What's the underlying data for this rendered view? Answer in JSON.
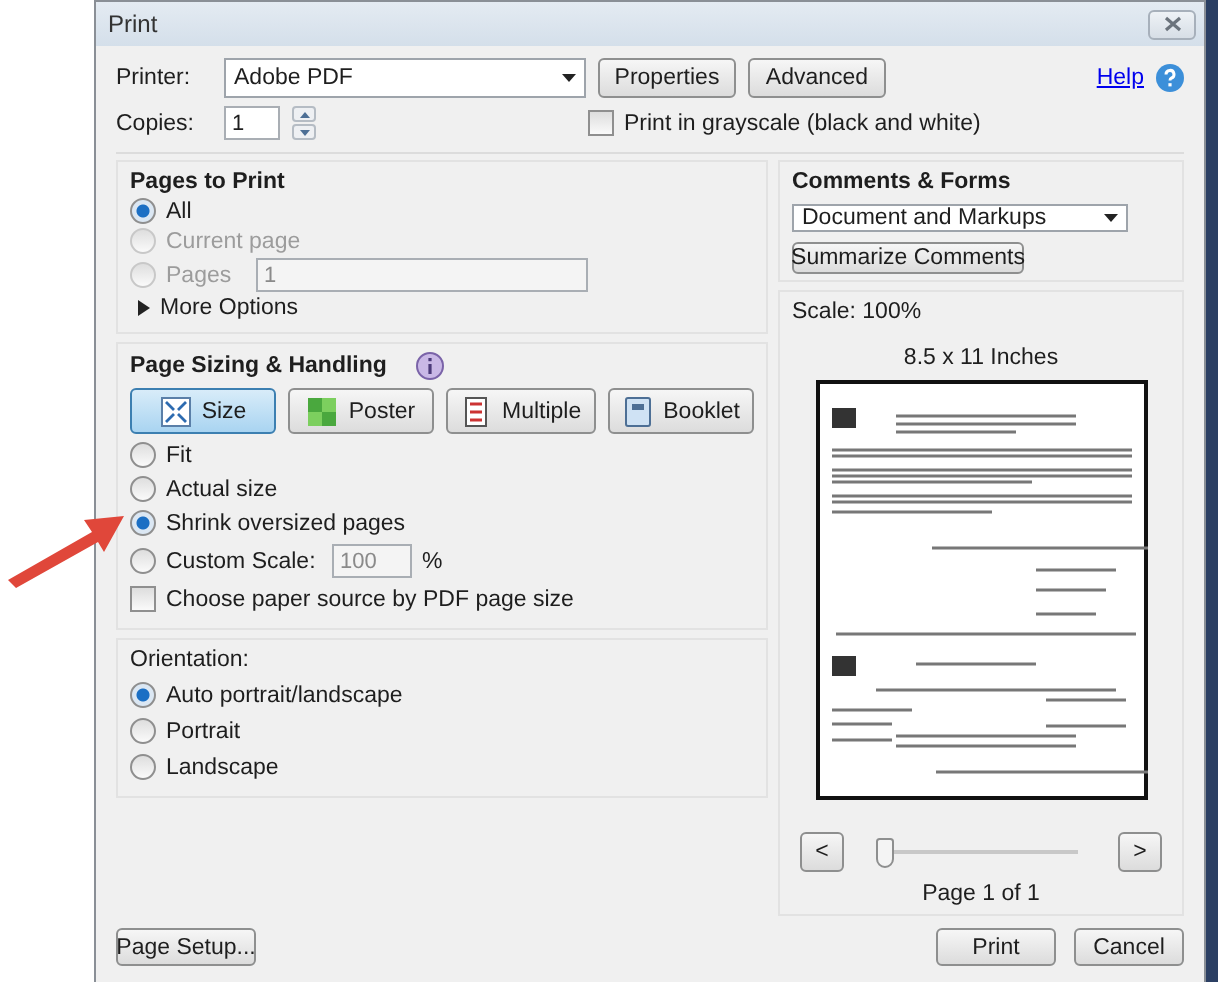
{
  "window": {
    "title": "Print"
  },
  "printer": {
    "label": "Printer:",
    "value": "Adobe PDF",
    "buttons": [
      "Properties",
      "Advanced"
    ],
    "help": "Help"
  },
  "copies": {
    "label": "Copies:",
    "value": "1"
  },
  "grayscale": {
    "label": "Print in grayscale (black and white)",
    "checked": false
  },
  "pages_to_print": {
    "title": "Pages to Print",
    "options": [
      {
        "label": "All",
        "selected": true,
        "disabled": false
      },
      {
        "label": "Current page",
        "selected": false,
        "disabled": true
      },
      {
        "label": "Pages",
        "selected": false,
        "disabled": true,
        "value": "1"
      }
    ],
    "more_options": "More Options"
  },
  "page_sizing": {
    "title": "Page Sizing & Handling",
    "modes": [
      {
        "label": "Size",
        "selected": true
      },
      {
        "label": "Poster",
        "selected": false
      },
      {
        "label": "Multiple",
        "selected": false
      },
      {
        "label": "Booklet",
        "selected": false
      }
    ],
    "options": [
      {
        "label": "Fit",
        "selected": false
      },
      {
        "label": "Actual size",
        "selected": false
      },
      {
        "label": "Shrink oversized pages",
        "selected": true
      },
      {
        "label": "Custom Scale:",
        "selected": false,
        "value": "100",
        "suffix": "%"
      }
    ],
    "paper_source": {
      "label": "Choose paper source by PDF page size",
      "checked": false
    }
  },
  "orientation": {
    "title": "Orientation:",
    "options": [
      {
        "label": "Auto portrait/landscape",
        "selected": true
      },
      {
        "label": "Portrait",
        "selected": false
      },
      {
        "label": "Landscape",
        "selected": false
      }
    ]
  },
  "comments": {
    "title": "Comments & Forms",
    "value": "Document and Markups",
    "button": "Summarize Comments"
  },
  "preview": {
    "scale": "Scale: 100%",
    "paper": "8.5 x 11 Inches",
    "prev": "<",
    "next": ">",
    "level": 0,
    "page": "Page 1 of 1"
  },
  "footer": {
    "page_setup": "Page Setup...",
    "buttons": [
      "Print",
      "Cancel"
    ]
  }
}
